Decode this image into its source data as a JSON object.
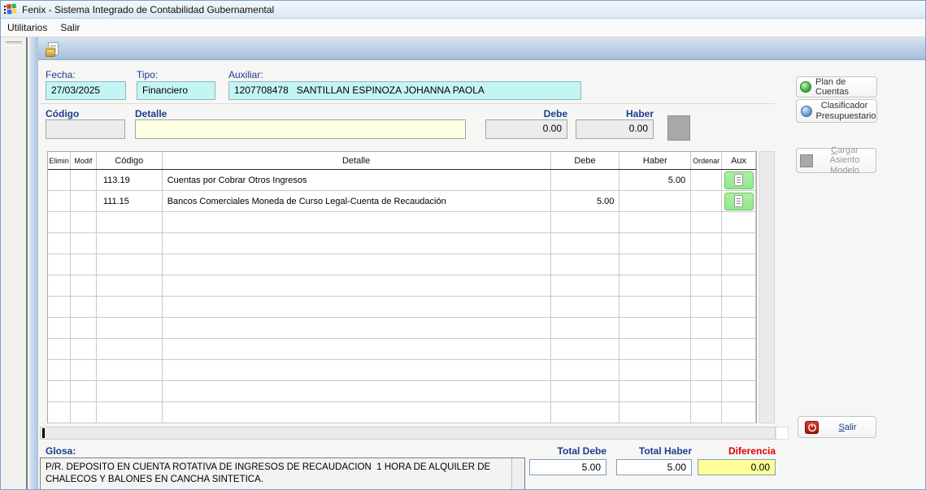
{
  "window": {
    "title": "Fenix - Sistema Integrado de Contabilidad Gubernamental"
  },
  "menu": {
    "utilitarios": "Utilitarios",
    "salir": "Salir"
  },
  "header_fields": {
    "fecha_label": "Fecha:",
    "fecha_value": "27/03/2025",
    "tipo_label": "Tipo:",
    "tipo_value": "Financiero",
    "auxiliar_label": "Auxiliar:",
    "auxiliar_value": "1207708478   SANTILLAN ESPINOZA JOHANNA PAOLA"
  },
  "entry": {
    "codigo_label": "Código",
    "detalle_label": "Detalle",
    "debe_label": "Debe",
    "haber_label": "Haber",
    "codigo_value": "",
    "detalle_value": "",
    "debe_value": "0.00",
    "haber_value": "0.00"
  },
  "table": {
    "columns": [
      "Elimin",
      "Modif",
      "Código",
      "Detalle",
      "Debe",
      "Haber",
      "Ordenar",
      "Aux"
    ],
    "rows": [
      {
        "elimin": "",
        "modif": "",
        "codigo": "113.19",
        "detalle": "Cuentas por Cobrar Otros Ingresos",
        "debe": "",
        "haber": "5.00",
        "ordenar": ""
      },
      {
        "elimin": "",
        "modif": "",
        "codigo": "111.15",
        "detalle": "Bancos Comerciales Moneda de Curso Legal-Cuenta de Recaudación",
        "debe": "5.00",
        "haber": "",
        "ordenar": ""
      }
    ],
    "empty_row_count": 10
  },
  "side_buttons": {
    "plan_de_cuentas": "Plan de Cuentas",
    "clasificador": "Clasificador Presupuestario",
    "cargar_asiento": "Cargar Asiento Modelo",
    "salir": "Salir"
  },
  "footer": {
    "glosa_label": "Glosa:",
    "glosa_text": "P/R. DEPOSITO EN CUENTA ROTATIVA DE INGRESOS DE RECAUDACION  1 HORA DE ALQUILER DE CHALECOS Y BALONES EN CANCHA SINTETICA.",
    "total_debe_label": "Total Debe",
    "total_debe": "5.00",
    "total_haber_label": "Total Haber",
    "total_haber": "5.00",
    "diferencia_label": "Diferencia",
    "diferencia": "0.00"
  },
  "colors": {
    "field_cyan": "#c4f5f5",
    "field_yellow": "#ffffe1",
    "diferencia_bg": "#ffff99",
    "label_navy": "#1b3c8f",
    "diferencia_red": "#dd0000",
    "aux_green": "#8fe88f",
    "toolbar_blue": "#a6bedb"
  }
}
